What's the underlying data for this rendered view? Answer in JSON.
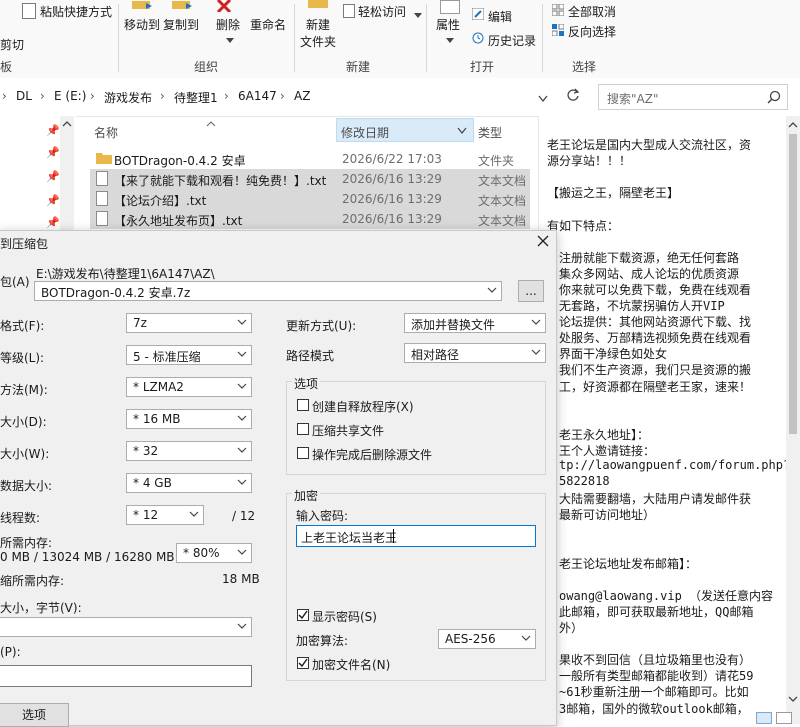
{
  "ribbon": {
    "paste_shortcut": "粘贴快捷方式",
    "cut_partial": "剪切",
    "clipboard_partial": "板",
    "move_to": "移动到",
    "copy_to": "复制到",
    "delete": "删除",
    "rename": "重命名",
    "organize": "组织",
    "new_folder": "新建\n文件夹",
    "new_folder_l1": "新建",
    "new_folder_l2": "文件夹",
    "easy_access": "轻松访问",
    "new_group": "新建",
    "properties": "属性",
    "edit": "编辑",
    "history": "历史记录",
    "open_group": "打开",
    "select_none": "全部取消",
    "invert_selection": "反向选择",
    "select_group": "选择"
  },
  "address": {
    "crumbs": [
      "DL",
      "E (E:)",
      "游戏发布",
      "待整理1",
      "6A147",
      "AZ"
    ],
    "search_placeholder": "搜索\"AZ\""
  },
  "explorer": {
    "columns": {
      "name": "名称",
      "date": "修改日期",
      "type": "类型"
    },
    "files": [
      {
        "name": "BOTDragon-0.4.2 安卓",
        "date": "2026/6/22 17:03",
        "type": "文件夹",
        "selected": false,
        "icon": "folder-icon"
      },
      {
        "name": "【来了就能下载和观看！纯免费！】.txt",
        "date": "2026/6/16 13:29",
        "type": "文本文档",
        "selected": true,
        "icon": "text-file-icon"
      },
      {
        "name": "【论坛介绍】.txt",
        "date": "2026/6/16 13:29",
        "type": "文本文档",
        "selected": true,
        "icon": "text-file-icon"
      },
      {
        "name": "【永久地址发布页】.txt",
        "date": "2026/6/16 13:29",
        "type": "文本文档",
        "selected": true,
        "icon": "text-file-icon"
      }
    ]
  },
  "preview": {
    "lines": [
      "老王论坛是国内大型成人交流社区，资",
      "源分享站！！！",
      "",
      "【搬运之王，隔壁老王】",
      "",
      "有如下特点：",
      "",
      "注册就能下载资源，绝无任何套路",
      "集众多网站、成人论坛的优质资源",
      "你来就可以免费下载，免费在线观看",
      "无套路，不坑蒙拐骗仿人开VIP",
      "论坛提供：其他网站资源代下载、找",
      "处服务、万部精选视频免费在线观看",
      "界面干净绿色如处女",
      "我们不生产资源，我们只是资源的搬",
      "工，好资源都在隔壁老王家，速来！",
      "",
      "",
      "老王永久地址】：",
      "王个人邀请链接：",
      "tp://laowangpuenf.com/forum.php?",
      "5822818",
      "大陆需要翻墙，大陆用户请发邮件获",
      "最新可访问地址）",
      "",
      "",
      "老王论坛地址发布邮箱】：",
      "",
      "owang@laowang.vip  （发送任意内容",
      "此邮箱，即可获取最新地址，QQ邮箱",
      "外）",
      "",
      "果收不到回信（且垃圾箱里也没有）",
      "一般所有类型邮箱都能收到）请花59",
      "~61秒重新注册一个邮箱即可。比如",
      "3邮箱，国外的微软outlook邮箱，"
    ]
  },
  "dialog": {
    "title": "到压缩包",
    "archive_label": "包(A)",
    "archive_path": "E:\\游戏发布\\待整理1\\6A147\\AZ\\",
    "archive_name": "BOTDragon-0.4.2 安卓.7z",
    "browse": "...",
    "format_label": "格式(F):",
    "format_value": "7z",
    "level_label": "等级(L):",
    "level_value": "5 - 标准压缩",
    "method_label": "方法(M):",
    "method_value": "* LZMA2",
    "dict_label": "大小(D):",
    "dict_value": "* 16 MB",
    "word_label": "大小(W):",
    "word_value": "* 32",
    "solid_label": "数据大小:",
    "solid_value": "* 4 GB",
    "threads_label": "线程数:",
    "threads_value": "* 12",
    "threads_total": "/ 12",
    "mem_label": "所需内存:",
    "mem_value": "0 MB / 13024 MB / 16280 MB",
    "mem_percent": "* 80%",
    "decomp_label": "缩所需内存:",
    "decomp_value": "18 MB",
    "split_label": "大小，字节(V):",
    "params_label": "(P):",
    "options_button": "选项",
    "update_label": "更新方式(U):",
    "update_value": "添加并替换文件",
    "pathmode_label": "路径模式",
    "pathmode_value": "相对路径",
    "options_group": "选项",
    "opt_sfx": "创建自释放程序(X)",
    "opt_shared": "压缩共享文件",
    "opt_delete": "操作完成后删除源文件",
    "encrypt_group": "加密",
    "password_label": "输入密码:",
    "password_value": "上老王论坛当老王",
    "show_password": "显示密码(S)",
    "algo_label": "加密算法:",
    "algo_value": "AES-256",
    "encrypt_names": "加密文件名(N)"
  },
  "colors": {
    "selection": "#d9d9d9",
    "accent": "#0078d7",
    "folder": "#e8b84a"
  }
}
